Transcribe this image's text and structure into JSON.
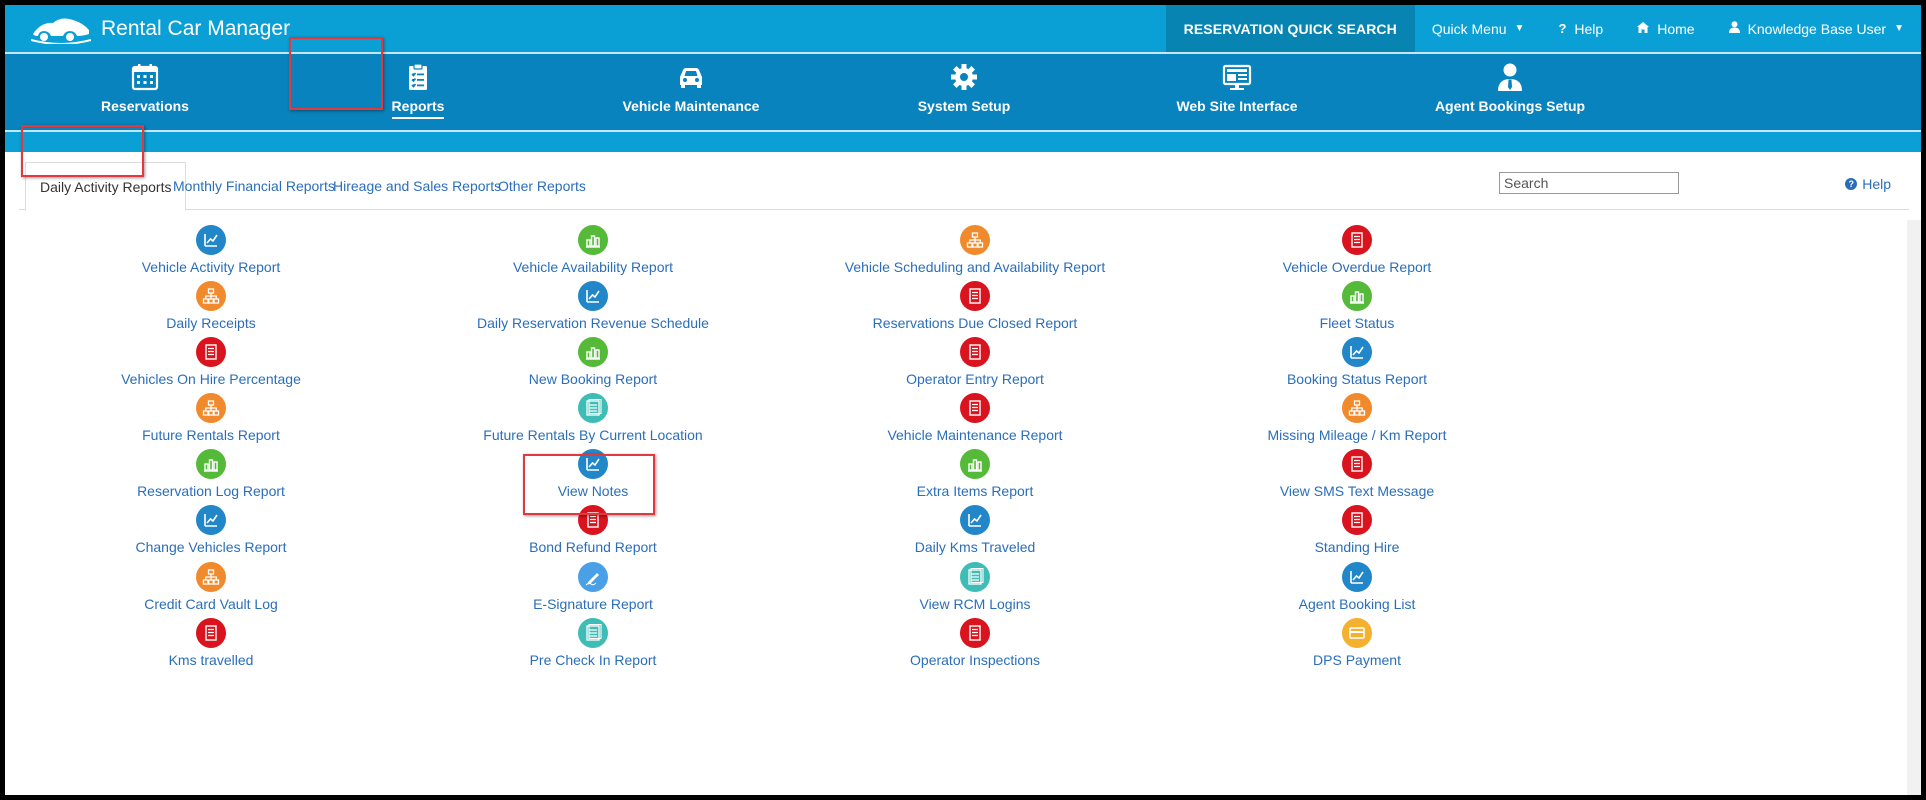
{
  "app": {
    "title": "Rental Car Manager"
  },
  "topnav": {
    "quick_search": "RESERVATION QUICK SEARCH",
    "quick_menu": "Quick Menu",
    "help": "Help",
    "home": "Home",
    "user": "Knowledge Base User"
  },
  "modules": [
    {
      "label": "Reservations",
      "icon": "calendar-icon"
    },
    {
      "label": "Reports",
      "icon": "clipboard-icon",
      "active": true
    },
    {
      "label": "Vehicle Maintenance",
      "icon": "car-icon"
    },
    {
      "label": "System Setup",
      "icon": "gear-icon"
    },
    {
      "label": "Web Site Interface",
      "icon": "monitor-icon"
    },
    {
      "label": "Agent Bookings Setup",
      "icon": "agent-icon"
    }
  ],
  "tabs": [
    {
      "label": "Daily Activity Reports",
      "active": true
    },
    {
      "label": "Monthly Financial Reports"
    },
    {
      "label": "Hireage and Sales Reports"
    },
    {
      "label": "Other Reports"
    }
  ],
  "search": {
    "placeholder": "Search"
  },
  "help_link": "Help",
  "colors": {
    "topbar": "#0aa0d6",
    "modbar": "#0883bd",
    "link": "#2a6ebb",
    "highlight": "#e0393e"
  },
  "reports": {
    "col1": [
      {
        "label": "Vehicle Activity Report",
        "icon": "chart-icon",
        "color": "blue"
      },
      {
        "label": "Daily Receipts",
        "icon": "network-icon",
        "color": "orange"
      },
      {
        "label": "Vehicles On Hire Percentage",
        "icon": "document-icon",
        "color": "red"
      },
      {
        "label": "Future Rentals Report",
        "icon": "network-icon",
        "color": "orange"
      },
      {
        "label": "Reservation Log Report",
        "icon": "bar-chart-icon",
        "color": "green"
      },
      {
        "label": "Change Vehicles Report",
        "icon": "chart-icon",
        "color": "blue"
      },
      {
        "label": "Credit Card Vault Log",
        "icon": "network-icon",
        "color": "orange"
      },
      {
        "label": "Kms travelled",
        "icon": "document-icon",
        "color": "red"
      }
    ],
    "col2": [
      {
        "label": "Vehicle Availability Report",
        "icon": "bar-chart-icon",
        "color": "green"
      },
      {
        "label": "Daily Reservation Revenue Schedule",
        "icon": "chart-icon",
        "color": "blue"
      },
      {
        "label": "New Booking Report",
        "icon": "bar-chart-icon",
        "color": "green"
      },
      {
        "label": "Future Rentals By Current Location",
        "icon": "list-icon",
        "color": "teal"
      },
      {
        "label": "View Notes",
        "icon": "chart-icon",
        "color": "blue"
      },
      {
        "label": "Bond Refund Report",
        "icon": "document-icon",
        "color": "red"
      },
      {
        "label": "E-Signature Report",
        "icon": "pen-icon",
        "color": "sky"
      },
      {
        "label": "Pre Check In Report",
        "icon": "list-icon",
        "color": "teal"
      }
    ],
    "col3": [
      {
        "label": "Vehicle Scheduling and Availability Report",
        "icon": "network-icon",
        "color": "orange"
      },
      {
        "label": "Reservations Due Closed Report",
        "icon": "document-icon",
        "color": "red"
      },
      {
        "label": "Operator Entry Report",
        "icon": "document-icon",
        "color": "red"
      },
      {
        "label": "Vehicle Maintenance Report",
        "icon": "document-icon",
        "color": "red"
      },
      {
        "label": "Extra Items Report",
        "icon": "bar-chart-icon",
        "color": "green"
      },
      {
        "label": "Daily Kms Traveled",
        "icon": "chart-icon",
        "color": "blue"
      },
      {
        "label": "View RCM Logins",
        "icon": "list-icon",
        "color": "teal"
      },
      {
        "label": "Operator Inspections",
        "icon": "document-icon",
        "color": "red"
      }
    ],
    "col4": [
      {
        "label": "Vehicle Overdue Report",
        "icon": "document-icon",
        "color": "red"
      },
      {
        "label": "Fleet Status",
        "icon": "bar-chart-icon",
        "color": "green"
      },
      {
        "label": "Booking Status Report",
        "icon": "chart-icon",
        "color": "blue"
      },
      {
        "label": "Missing Mileage / Km Report",
        "icon": "network-icon",
        "color": "orange"
      },
      {
        "label": "View SMS Text Message",
        "icon": "document-icon",
        "color": "red"
      },
      {
        "label": "Standing Hire",
        "icon": "document-icon",
        "color": "red"
      },
      {
        "label": "Agent Booking List",
        "icon": "chart-icon",
        "color": "blue"
      },
      {
        "label": "DPS Payment",
        "icon": "card-icon",
        "color": "yellow"
      }
    ]
  }
}
